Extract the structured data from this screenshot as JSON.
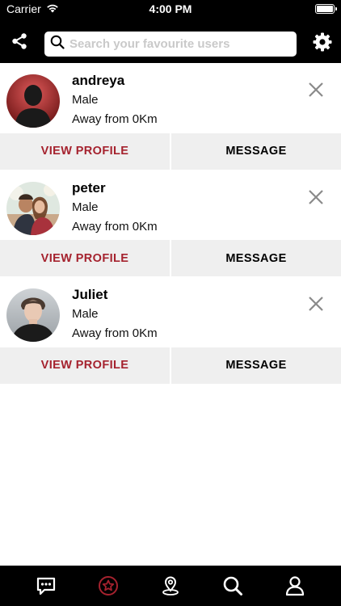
{
  "status_bar": {
    "carrier": "Carrier",
    "time": "4:00 PM",
    "icons": [
      "wifi-icon",
      "battery-icon"
    ]
  },
  "header": {
    "share_icon": "share-icon",
    "search": {
      "placeholder": "Search your favourite users",
      "value": "",
      "icon": "search-icon"
    },
    "settings_icon": "gear-icon"
  },
  "users": [
    {
      "name": "andreya",
      "gender": "Male",
      "distance": "Away from 0Km",
      "view_label": "VIEW PROFILE",
      "message_label": "MESSAGE"
    },
    {
      "name": "peter",
      "gender": "Male",
      "distance": "Away from 0Km",
      "view_label": "VIEW PROFILE",
      "message_label": "MESSAGE"
    },
    {
      "name": "Juliet",
      "gender": "Male",
      "distance": "Away from 0Km",
      "view_label": "VIEW PROFILE",
      "message_label": "MESSAGE"
    }
  ],
  "tab_bar": {
    "tabs": [
      "chat-icon",
      "favorites-star-icon",
      "location-pin-icon",
      "search-icon",
      "profile-icon"
    ],
    "active_tab": "favorites-star-icon"
  },
  "colors": {
    "accent": "#a5222e",
    "bar_background": "#000000",
    "button_background": "#efefef"
  }
}
